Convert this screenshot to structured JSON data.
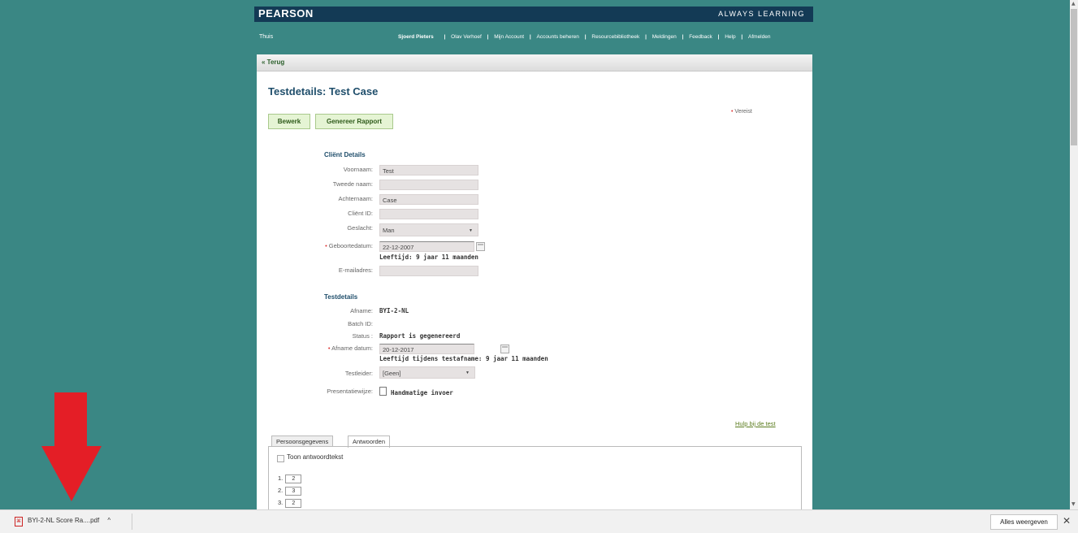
{
  "header": {
    "brand": "PEARSON",
    "tagline": "ALWAYS LEARNING",
    "home": "Thuis",
    "user": "Sjoerd Pieters",
    "nav": [
      "Olav Verhoef",
      "Mijn Account",
      "Accounts beheren",
      "Resourcebibliotheek",
      "Meldingen",
      "Feedback",
      "Help",
      "Afmelden"
    ],
    "separator": "|"
  },
  "panel": {
    "back": "« Terug",
    "title": "Testdetails: Test Case",
    "required_note": "Vereist",
    "required_star": "•",
    "edit_button": "Bewerk",
    "report_button": "Genereer Rapport"
  },
  "client": {
    "section": "Cliënt Details",
    "first_name_label": "Voornaam:",
    "first_name": "Test",
    "middle_name_label": "Tweede naam:",
    "middle_name": "",
    "last_name_label": "Achternaam:",
    "last_name": "Case",
    "client_id_label": "Cliënt ID:",
    "client_id": "",
    "gender_label": "Geslacht:",
    "gender": "Man",
    "dob_label": "Geboortedatum:",
    "dob": "22-12-2007",
    "age": "Leeftijd:  9 jaar 11 maanden",
    "email_label": "E-mailadres:",
    "email": ""
  },
  "test": {
    "section": "Testdetails",
    "afname_label": "Afname:",
    "afname": "BYI-2-NL",
    "batch_label": "Batch ID:",
    "batch": "",
    "status_label": "Status :",
    "status": "Rapport is gegenereerd",
    "date_label": "Afname datum:",
    "date": "20-12-2017",
    "age_at_test": "Leeftijd tijdens testafname:  9 jaar 11 maanden",
    "examiner_label": "Testleider:",
    "examiner": "[Geen]",
    "mode_label": "Presentatiewijze:",
    "mode": "Handmatige invoer"
  },
  "help_link": "Hulp bij de test",
  "tabs": [
    "Persoonsgegevens",
    "Antwoorden"
  ],
  "answers": {
    "show_text": "Toon antwoordtekst",
    "items": [
      {
        "num": "1.",
        "val": "2"
      },
      {
        "num": "2.",
        "val": "3"
      },
      {
        "num": "3.",
        "val": "2"
      }
    ]
  },
  "download_bar": {
    "file": "BYI-2-NL Score Ra....pdf",
    "chevron": "^",
    "show_all": "Alles weergeven",
    "close": "✕"
  }
}
